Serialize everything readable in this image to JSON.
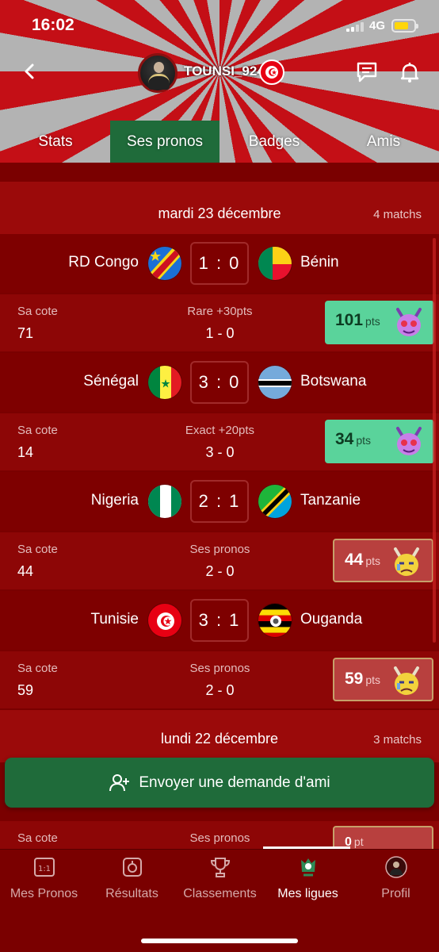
{
  "status": {
    "time": "16:02",
    "network": "4G"
  },
  "profile": {
    "username": "TOUNSI_924"
  },
  "tabs": [
    {
      "label": "Stats",
      "active": false
    },
    {
      "label": "Ses pronos",
      "active": true
    },
    {
      "label": "Badges",
      "active": false
    },
    {
      "label": "Amis",
      "active": false
    }
  ],
  "days": [
    {
      "title": "mardi 23 décembre",
      "count": "4 matchs"
    },
    {
      "title": "lundi 22 décembre",
      "count": "3 matchs"
    }
  ],
  "matches": [
    {
      "home": "RD Congo",
      "away": "Bénin",
      "score": "1 : 0",
      "cote_label": "Sa cote",
      "cote": "71",
      "mid_label": "Rare +30pts",
      "mid_value": "1 - 0",
      "pts": "101",
      "pts_unit": "pts",
      "pts_style": "green"
    },
    {
      "home": "Sénégal",
      "away": "Botswana",
      "score": "3 : 0",
      "cote_label": "Sa cote",
      "cote": "14",
      "mid_label": "Exact +20pts",
      "mid_value": "3 - 0",
      "pts": "34",
      "pts_unit": "pts",
      "pts_style": "green"
    },
    {
      "home": "Nigeria",
      "away": "Tanzanie",
      "score": "2 : 1",
      "cote_label": "Sa cote",
      "cote": "44",
      "mid_label": "Ses pronos",
      "mid_value": "2 - 0",
      "pts": "44",
      "pts_unit": "pts",
      "pts_style": "red"
    },
    {
      "home": "Tunisie",
      "away": "Ouganda",
      "score": "3 : 1",
      "cote_label": "Sa cote",
      "cote": "59",
      "mid_label": "Ses pronos",
      "mid_value": "2 - 0",
      "pts": "59",
      "pts_unit": "pts",
      "pts_style": "red"
    }
  ],
  "partial_row": {
    "cote_label": "Sa cote",
    "mid_label": "Ses pronos",
    "pts": "0",
    "pts_unit": "pt"
  },
  "friend_button": {
    "label": "Envoyer une demande d'ami"
  },
  "bottom_nav": [
    {
      "label": "Mes Pronos",
      "icon": "box-1-1-icon",
      "active": false
    },
    {
      "label": "Résultats",
      "icon": "timer-icon",
      "active": false
    },
    {
      "label": "Classements",
      "icon": "trophy-icon",
      "active": false
    },
    {
      "label": "Mes ligues",
      "icon": "league-icon",
      "active": true
    },
    {
      "label": "Profil",
      "icon": "avatar-icon",
      "active": false
    }
  ],
  "colors": {
    "background": "#7a0000",
    "active_green": "#1f6b3a",
    "pts_green": "#5ad39b",
    "pts_red": "#b8403e"
  }
}
